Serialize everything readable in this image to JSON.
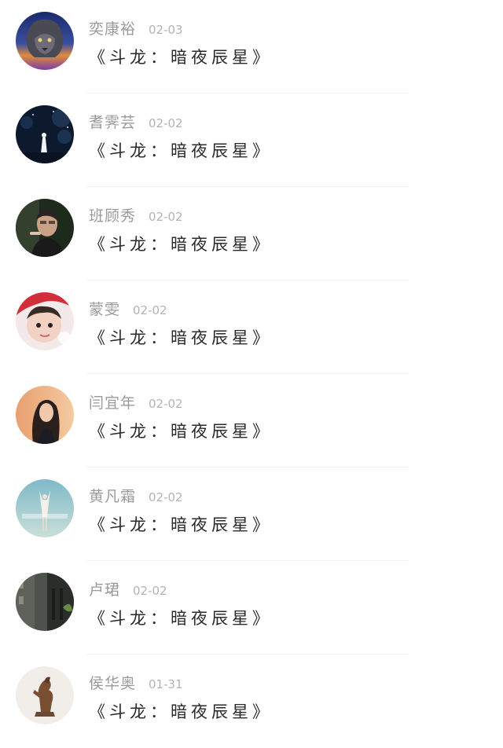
{
  "messages": [
    {
      "name": "奕康裕",
      "date": "02-03",
      "text": "《斗龙：暗夜辰星》",
      "avatar": "lion-avatar-icon"
    },
    {
      "name": "耆霁芸",
      "date": "02-02",
      "text": "《斗龙：暗夜辰星》",
      "avatar": "night-girl-avatar-icon"
    },
    {
      "name": "班顾秀",
      "date": "02-02",
      "text": "《斗龙：暗夜辰星》",
      "avatar": "man-avatar-icon"
    },
    {
      "name": "蒙雯",
      "date": "02-02",
      "text": "《斗龙：暗夜辰星》",
      "avatar": "baby-avatar-icon"
    },
    {
      "name": "闫宜年",
      "date": "02-02",
      "text": "《斗龙：暗夜辰星》",
      "avatar": "woman-avatar-icon"
    },
    {
      "name": "黄凡霜",
      "date": "02-02",
      "text": "《斗龙：暗夜辰星》",
      "avatar": "girl-sky-avatar-icon"
    },
    {
      "name": "卢珺",
      "date": "02-02",
      "text": "《斗龙：暗夜辰星》",
      "avatar": "street-avatar-icon"
    },
    {
      "name": "侯华奥",
      "date": "01-31",
      "text": "《斗龙：暗夜辰星》",
      "avatar": "horse-statue-avatar-icon"
    }
  ]
}
